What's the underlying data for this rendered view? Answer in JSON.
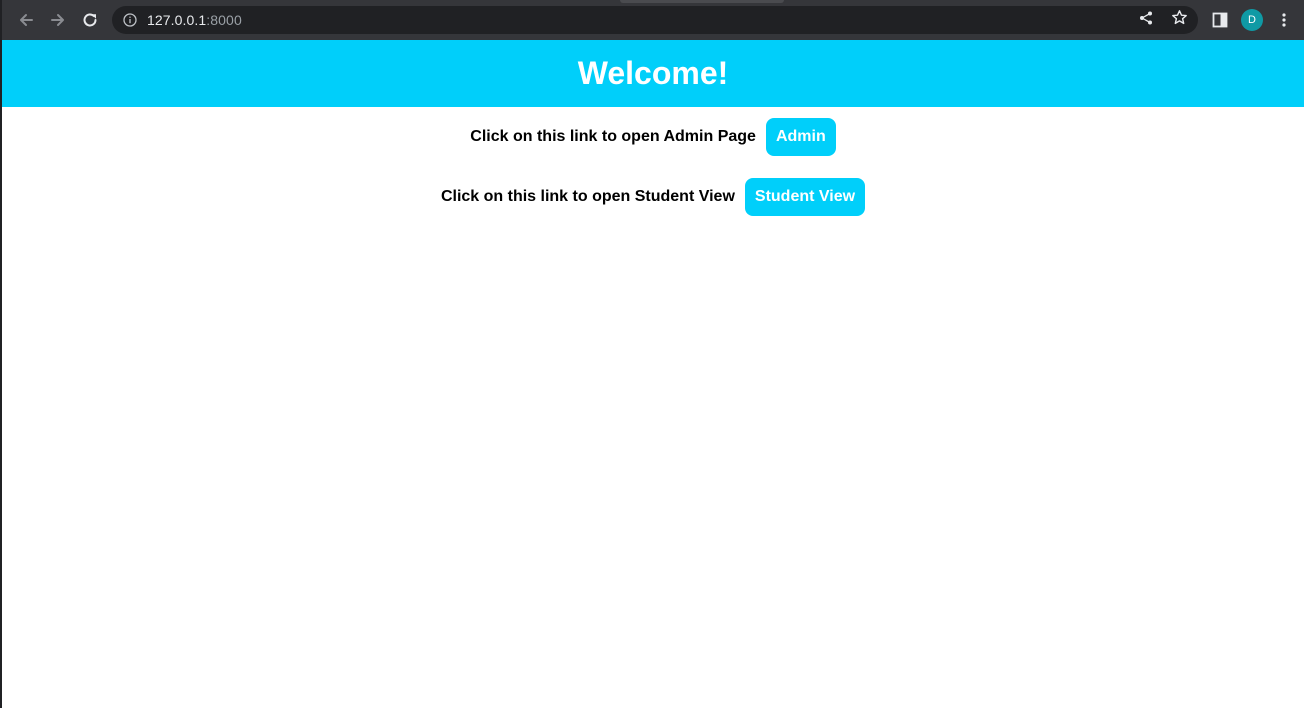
{
  "browser": {
    "url_host": "127.0.0.1",
    "url_port": ":8000",
    "profile_initial": "D",
    "icons": {
      "back": "arrow-left-icon",
      "forward": "arrow-right-icon",
      "reload": "reload-icon",
      "site_info": "info-icon",
      "share": "share-icon",
      "bookmark": "star-icon",
      "side_panel": "side-panel-icon",
      "menu": "kebab-menu-icon"
    }
  },
  "page": {
    "heading": "Welcome!",
    "links": [
      {
        "label": "Click on this link to open Admin Page",
        "button": "Admin"
      },
      {
        "label": "Click on this link to open Student View",
        "button": "Student View"
      }
    ]
  },
  "colors": {
    "accent": "#00cffa",
    "toolbar": "#35363a",
    "omnibox": "#202124",
    "avatar": "#0f9aa5"
  }
}
